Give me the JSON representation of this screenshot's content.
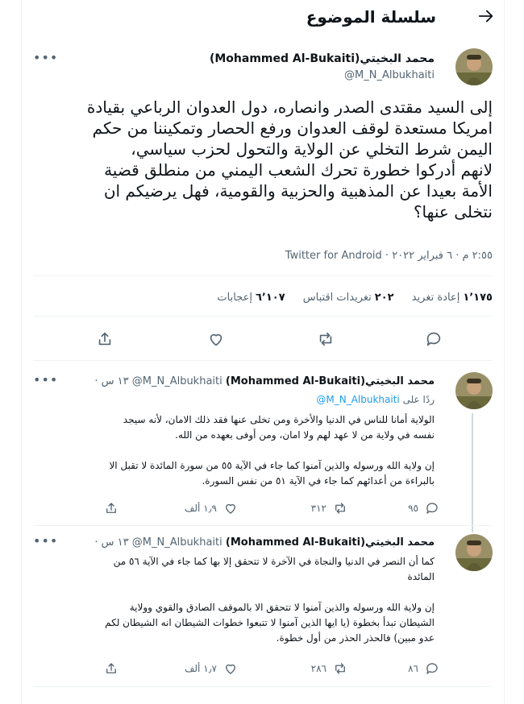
{
  "header": {
    "title": "سلسلة الموضوع",
    "back_icon": "arrow-right"
  },
  "main_tweet": {
    "author_name": "محمد البخيتي(Mohammed Al-Bukaiti)",
    "handle": "@M_N_Albukhaiti",
    "text": "إلى السيد مقتدى الصدر وانصاره، دول العدوان الرباعي بقيادة\nامريكا مستعدة لوقف العدوان ورفع الحصار وتمكيننا من حكم\nاليمن شرط التخلي عن الولاية والتحول لحزب سياسي،\nلانهم أدركوا خطورة تحرك الشعب اليمني من منطلق قضية\nالأمة بعيدا عن المذهبية والحزبية والقومية، فهل يرضيكم ان\nنتخلى عنها؟",
    "meta": "٢:٥٥ م · ٦ فبراير ٢٠٢٢ · Twitter for Android",
    "retweets_count": "١٬١٧٥",
    "retweets_label": "إعادة تغريد",
    "quotes_count": "٢٠٢",
    "quotes_label": "تغريدات اقتباس",
    "likes_count": "٦٬١٠٧",
    "likes_label": "إعجابات"
  },
  "replies": [
    {
      "author_name": "محمد البخيتي(Mohammed Al-Bukaiti)",
      "handle": "@M_N_Albukhaiti",
      "time": "١٣ س ·",
      "replying_prefix": "ردًا على",
      "replying_to": "@M_N_Albukhaiti",
      "text": "الولاية أمانا للناس في الدنيا والأخرة ومن تخلى عنها فقد ذلك الامان، لأنه سيجد\nنفسه في ولاية من لا عهد لهم ولا امان، ومن أوفى بعهده من الله.\n\nإن ولاية الله ورسوله والذين آمنوا كما جاء في الآية ٥٥ من سورة المائدة لا تقبل الا\nبالبراءة من أعدائهم كما جاء في الآية ٥١ من نفس السورة.",
      "replies_count": "٩٥",
      "retweets_count": "٣١٢",
      "likes_count": "١٫٩ ألف"
    },
    {
      "author_name": "محمد البخيتي(Mohammed Al-Bukaiti)",
      "handle": "@M_N_Albukhaiti",
      "time": "١٣ س ·",
      "text": "كما أن النصر في الدنيا والنجاة في الآخرة لا تتحقق إلا بها كما جاء في الآية ٥٦ من\nالمائدة\n\nإن ولاية الله ورسوله والذين آمنوا لا تتحقق الا بالموقف الصادق والقوي وولاية\nالشيطان تبدأ بخطوة (يا ايها الذين آمنوا لا تتبعوا خطوات الشيطان انه الشيطان لكم\nعدو مبين) فالحذر الحذر من أول خطوة.",
      "replies_count": "٨٦",
      "retweets_count": "٢٨٦",
      "likes_count": "١٫٧ ألف"
    }
  ]
}
